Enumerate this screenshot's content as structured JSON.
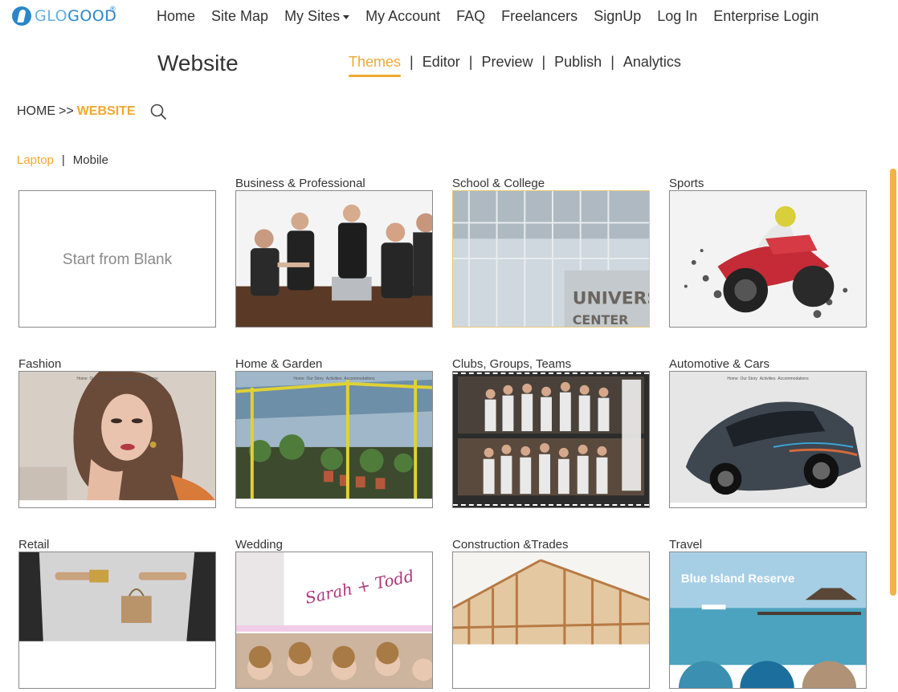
{
  "brand": {
    "name_part1": "GLO",
    "name_part2": "GOOD",
    "reg": "®"
  },
  "nav": {
    "items": [
      "Home",
      "Site Map",
      "My Sites",
      "My Account",
      "FAQ",
      "Freelancers",
      "SignUp",
      "Log In",
      "Enterprise Login"
    ]
  },
  "page": {
    "title": "Website"
  },
  "tabs": [
    "Themes",
    "Editor",
    "Preview",
    "Publish",
    "Analytics"
  ],
  "breadcrumb": {
    "home": "HOME",
    "sep": ">>",
    "current": "WEBSITE"
  },
  "device": {
    "laptop": "Laptop",
    "sep": "|",
    "mobile": "Mobile"
  },
  "tab_sep": "|",
  "cards": {
    "blank": {
      "label": "Start from Blank"
    },
    "business": {
      "title": "Business & Professional"
    },
    "school": {
      "title": "School & College",
      "sign": "UNIVERSITY",
      "sign2": "CENTER"
    },
    "sports": {
      "title": "Sports"
    },
    "fashion": {
      "title": "Fashion"
    },
    "home_garden": {
      "title": "Home & Garden"
    },
    "clubs": {
      "title": "Clubs, Groups, Teams"
    },
    "automotive": {
      "title": "Automotive & Cars"
    },
    "retail": {
      "title": "Retail"
    },
    "wedding": {
      "title": "Wedding",
      "script": "Sarah + Todd"
    },
    "construction": {
      "title": "Construction &Trades"
    },
    "travel": {
      "title": "Travel",
      "banner": "Blue Island Reserve"
    }
  },
  "theme_mini_nav": {
    "home": "Home",
    "story": "Our Story",
    "activities": "Activities",
    "accommodations": "Accommodations"
  },
  "colors": {
    "accent": "#f0a830",
    "brand": "#2a86c9",
    "text": "#333333"
  }
}
